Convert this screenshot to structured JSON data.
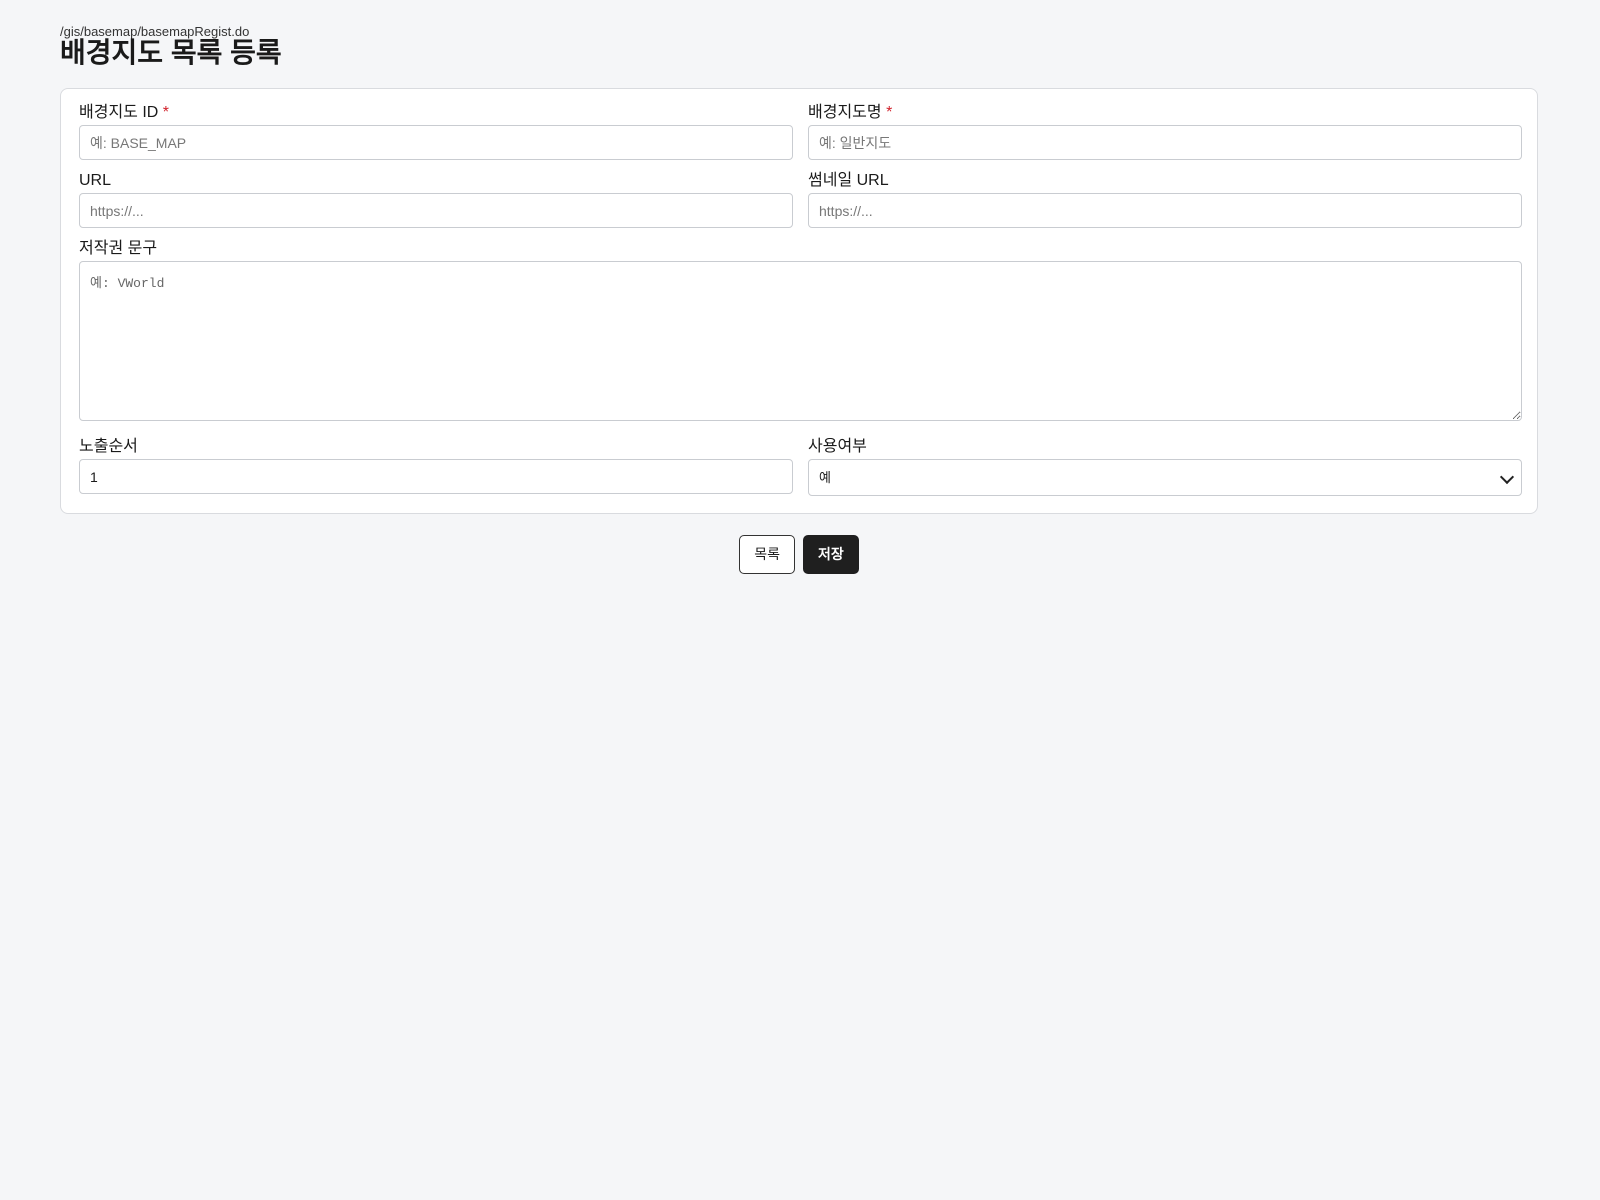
{
  "header": {
    "path": "/gis/basemap/basemapRegist.do",
    "title": "배경지도 목록 등록"
  },
  "form": {
    "basemap_id": {
      "label": "배경지도 ID",
      "required_mark": "*",
      "value": "",
      "placeholder": "예: BASE_MAP"
    },
    "basemap_name": {
      "label": "배경지도명",
      "required_mark": "*",
      "value": "",
      "placeholder": "예: 일반지도"
    },
    "url": {
      "label": "URL",
      "value": "",
      "placeholder": "https://..."
    },
    "thumbnail_url": {
      "label": "썸네일 URL",
      "value": "",
      "placeholder": "https://..."
    },
    "copyright": {
      "label": "저작권 문구",
      "value": "",
      "placeholder": "예: VWorld"
    },
    "display_order": {
      "label": "노출순서",
      "value": "1",
      "placeholder": ""
    },
    "use_yn": {
      "label": "사용여부",
      "selected": "예"
    }
  },
  "actions": {
    "list_label": "목록",
    "save_label": "저장"
  },
  "colors": {
    "background": "#f5f6f8",
    "required": "#d0202a",
    "primary_button": "#1f1f1f"
  },
  "icons": {
    "select_arrow": "chevron-down-icon"
  }
}
